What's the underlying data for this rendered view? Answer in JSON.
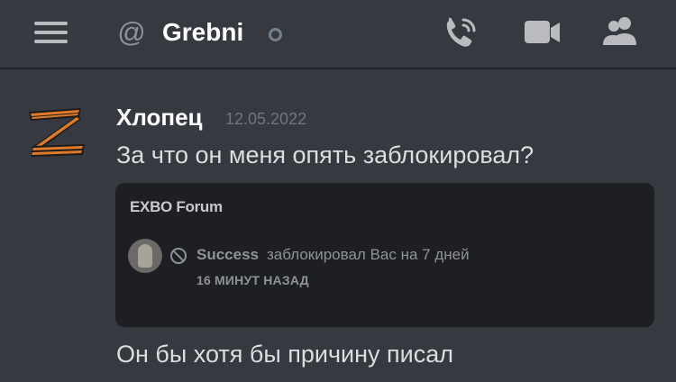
{
  "header": {
    "channel_prefix": "@",
    "channel_name": "Grebni",
    "icons": [
      "menu-icon",
      "at-icon",
      "status-offline-icon",
      "call-icon",
      "video-call-icon",
      "members-icon"
    ]
  },
  "message": {
    "author": "Хлопец",
    "timestamp": "12.05.2022",
    "lines": [
      "За что он меня опять заблокировал?",
      "Он бы хотя бы причину писал"
    ],
    "avatar_icon": "z-ribbon-icon"
  },
  "embed": {
    "title": "EXBO Forum",
    "user": "Success",
    "action": "заблокировал Вас на 7 дней",
    "time": "16 МИНУТ НАЗАД",
    "icon": "ban-icon"
  },
  "colors": {
    "background": "#36393f",
    "header_border": "#202225",
    "embed_background": "#1e1f22",
    "author": "#ffffff",
    "text": "#dcddde",
    "muted": "#72767d",
    "ribbon_orange": "#e07a2b",
    "ribbon_black": "#1c1c1c"
  }
}
